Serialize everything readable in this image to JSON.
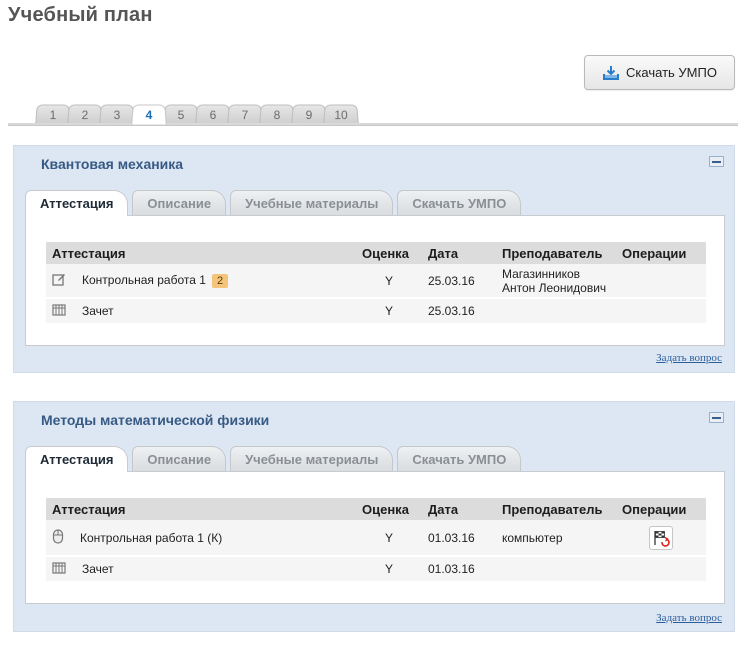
{
  "page": {
    "title": "Учебный план"
  },
  "toolbar": {
    "download_label": "Скачать УМПО",
    "download_icon": "download-tray-icon"
  },
  "semesters": {
    "tabs": [
      "1",
      "2",
      "3",
      "4",
      "5",
      "6",
      "7",
      "8",
      "9",
      "10"
    ],
    "active": "4"
  },
  "courses": [
    {
      "title": "Квантовая механика",
      "tabs": [
        "Аттестация",
        "Описание",
        "Учебные материалы",
        "Скачать УМПО"
      ],
      "active_tab": "Аттестация",
      "table": {
        "headers": [
          "Аттестация",
          "Оценка",
          "Дата",
          "Преподаватель",
          "Операции"
        ],
        "rows": [
          {
            "icon": "edit-icon",
            "name": "Контрольная работа 1",
            "badge": "2",
            "grade": "Y",
            "date": "25.03.16",
            "teacher_line1": "Магазинников",
            "teacher_line2": "Антон Леонидович",
            "operation_icon": ""
          },
          {
            "icon": "gradebook-icon",
            "name": "Зачет",
            "badge": "",
            "grade": "Y",
            "date": "25.03.16",
            "teacher_line1": "",
            "teacher_line2": "",
            "operation_icon": ""
          }
        ]
      },
      "ask_link": "Задать вопрос"
    },
    {
      "title": "Методы математической физики",
      "tabs": [
        "Аттестация",
        "Описание",
        "Учебные материалы",
        "Скачать УМПО"
      ],
      "active_tab": "Аттестация",
      "table": {
        "headers": [
          "Аттестация",
          "Оценка",
          "Дата",
          "Преподаватель",
          "Операции"
        ],
        "rows": [
          {
            "icon": "mouse-icon",
            "name": "Контрольная работа 1 (К)",
            "badge": "",
            "grade": "Y",
            "date": "01.03.16",
            "teacher_line1": "компьютер",
            "teacher_line2": "",
            "operation_icon": "flag-refresh-icon"
          },
          {
            "icon": "gradebook-icon",
            "name": "Зачет",
            "badge": "",
            "grade": "Y",
            "date": "01.03.16",
            "teacher_line1": "",
            "teacher_line2": "",
            "operation_icon": ""
          }
        ]
      },
      "ask_link": "Задать вопрос"
    }
  ],
  "colors": {
    "panel_bg": "#dde7f3",
    "title_blue": "#375a84",
    "active_semester": "#1a6fb5",
    "badge": "#f3c47a",
    "link": "#2d5e9c"
  }
}
